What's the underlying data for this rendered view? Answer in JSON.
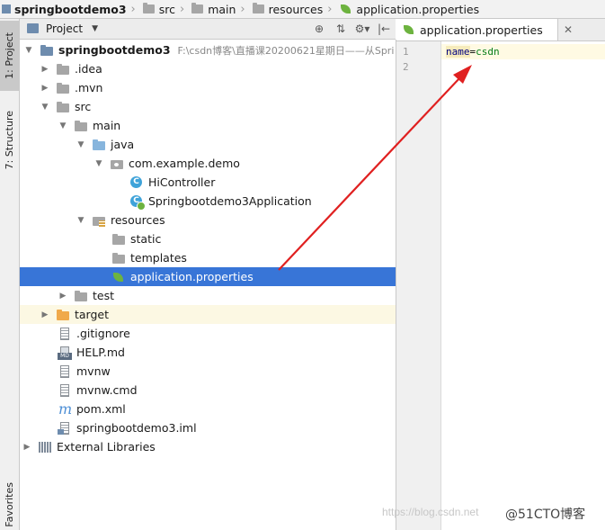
{
  "breadcrumb": [
    {
      "label": "springbootdemo3",
      "icon": "module-icon"
    },
    {
      "label": "src",
      "icon": "folder-icon"
    },
    {
      "label": "main",
      "icon": "folder-icon"
    },
    {
      "label": "resources",
      "icon": "resources-folder-icon"
    },
    {
      "label": "application.properties",
      "icon": "spring-leaf-icon"
    }
  ],
  "tool_strip": {
    "project_tab": "1: Project",
    "structure_tab": "7: Structure",
    "favorites_tab": "Favorites"
  },
  "project_panel": {
    "title": "Project",
    "tools": [
      "globe-icon",
      "collapse-icon",
      "gear-icon",
      "hide-icon"
    ]
  },
  "tree": [
    {
      "label": "springbootdemo3",
      "note": "F:\\csdn博客\\直播课20200621星期日——从Spri",
      "icon": "module-folder-icon",
      "depth": 0,
      "expanded": true
    },
    {
      "label": ".idea",
      "icon": "folder-icon",
      "depth": 1,
      "expanded": false
    },
    {
      "label": ".mvn",
      "icon": "folder-icon",
      "depth": 1,
      "expanded": false
    },
    {
      "label": "src",
      "icon": "folder-icon",
      "depth": 1,
      "expanded": true
    },
    {
      "label": "main",
      "icon": "folder-icon",
      "depth": 2,
      "expanded": true
    },
    {
      "label": "java",
      "icon": "source-folder-icon",
      "depth": 3,
      "expanded": true
    },
    {
      "label": "com.example.demo",
      "icon": "package-icon",
      "depth": 4,
      "expanded": true
    },
    {
      "label": "HiController",
      "icon": "class-icon",
      "depth": 5
    },
    {
      "label": "Springbootdemo3Application",
      "icon": "spring-boot-class-icon",
      "depth": 5
    },
    {
      "label": "resources",
      "icon": "resources-folder-icon",
      "depth": 3,
      "expanded": true
    },
    {
      "label": "static",
      "icon": "folder-icon",
      "depth": 4
    },
    {
      "label": "templates",
      "icon": "folder-icon",
      "depth": 4
    },
    {
      "label": "application.properties",
      "icon": "spring-leaf-icon",
      "depth": 4,
      "selected": true
    },
    {
      "label": "test",
      "icon": "folder-icon",
      "depth": 2,
      "expanded": false
    },
    {
      "label": "target",
      "icon": "excluded-folder-icon",
      "depth": 1,
      "expanded": false,
      "highlight": true
    },
    {
      "label": ".gitignore",
      "icon": "text-file-icon",
      "depth": 1
    },
    {
      "label": "HELP.md",
      "icon": "markdown-file-icon",
      "depth": 1
    },
    {
      "label": "mvnw",
      "icon": "text-file-icon",
      "depth": 1
    },
    {
      "label": "mvnw.cmd",
      "icon": "text-file-icon",
      "depth": 1
    },
    {
      "label": "pom.xml",
      "icon": "maven-icon",
      "depth": 1
    },
    {
      "label": "springbootdemo3.iml",
      "icon": "iml-file-icon",
      "depth": 1
    },
    {
      "label": "External Libraries",
      "icon": "libraries-icon",
      "depth": 0,
      "expanded": false
    }
  ],
  "editor": {
    "tab_label": "application.properties",
    "line_numbers": [
      "1",
      "2"
    ],
    "code": {
      "key": "name",
      "eq": "=",
      "value": "csdn"
    }
  },
  "watermark": {
    "url": "https://blog.csdn.net",
    "brand": "@51CTO博客"
  },
  "colors": {
    "selection": "#3875d7",
    "annotation_arrow": "#e02020"
  }
}
